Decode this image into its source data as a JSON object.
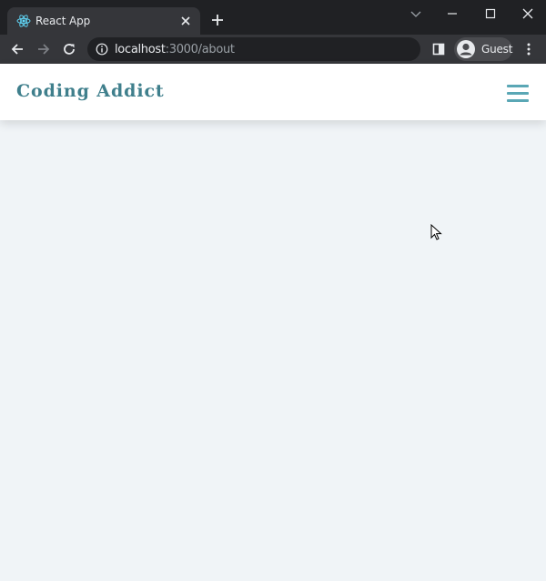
{
  "browser": {
    "tab_title": "React App",
    "url_host": "localhost",
    "url_path": ":3000/about",
    "profile_label": "Guest",
    "colors": {
      "frame": "#202124",
      "toolbar": "#35363a",
      "text": "#e8eaed",
      "muted": "#9aa0a6"
    }
  },
  "page": {
    "brand": "Coding Addict",
    "menu_icon": "hamburger-icon",
    "colors": {
      "brand": "#3f7f8c",
      "menu": "#5aa7b5",
      "background": "#f0f4f7",
      "navbar": "#ffffff"
    }
  }
}
